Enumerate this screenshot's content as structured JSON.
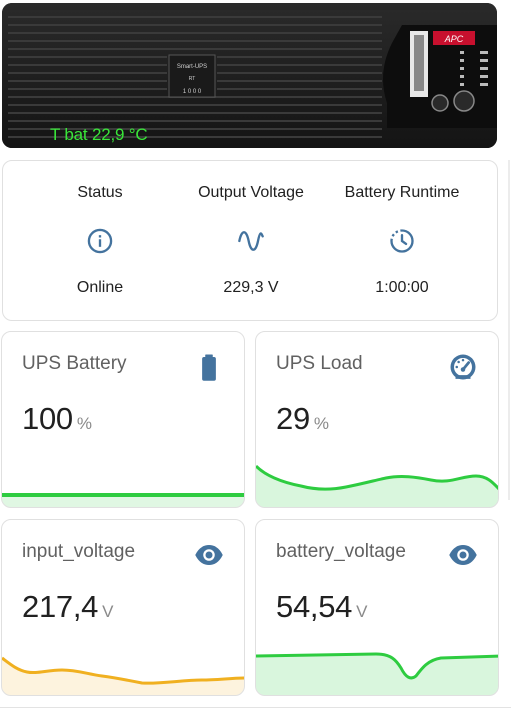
{
  "picture_card": {
    "overlay_text": "T bat 22,9 °C",
    "ups_front_labels": [
      "Smart-UPS",
      "RT",
      "1 0 0 0"
    ],
    "brand_logo": "APC"
  },
  "glance": {
    "entities": [
      {
        "name": "Status",
        "icon": "information-outline-icon",
        "state": "Online"
      },
      {
        "name": "Output Voltage",
        "icon": "sine-wave-icon",
        "state": "229,3 V"
      },
      {
        "name": "Battery Runtime",
        "icon": "clock-history-icon",
        "state": "1:00:00"
      }
    ]
  },
  "sensors": [
    {
      "title": "UPS Battery",
      "icon": "battery-icon",
      "value": "100",
      "unit": "%",
      "graph_color": "#2ecc40"
    },
    {
      "title": "UPS Load",
      "icon": "gauge-icon",
      "value": "29",
      "unit": "%",
      "graph_color": "#2ecc40"
    },
    {
      "title": "input_voltage",
      "icon": "eye-icon",
      "value": "217,4",
      "unit": "V",
      "graph_color": "#f0b020"
    },
    {
      "title": "battery_voltage",
      "icon": "eye-icon",
      "value": "54,54",
      "unit": "V",
      "graph_color": "#2ecc40"
    }
  ],
  "colors": {
    "icon_blue": "#44739e",
    "overlay_green": "#39e639",
    "card_border": "#e0e0e0"
  }
}
